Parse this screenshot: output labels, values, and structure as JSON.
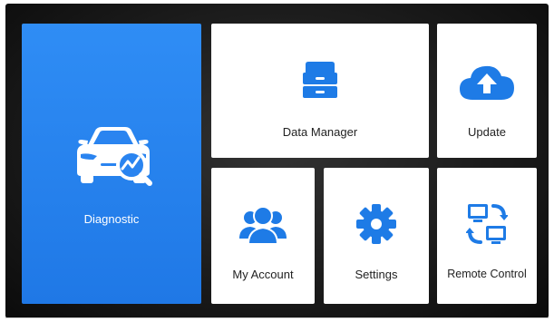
{
  "tiles": {
    "diagnostic": {
      "label": "Diagnostic",
      "icon": "car-diagnostic-icon"
    },
    "data_manager": {
      "label": "Data Manager",
      "icon": "file-cabinet-icon"
    },
    "update": {
      "label": "Update",
      "icon": "cloud-upload-icon"
    },
    "my_account": {
      "label": "My Account",
      "icon": "users-icon"
    },
    "settings": {
      "label": "Settings",
      "icon": "gear-icon"
    },
    "remote_control": {
      "label": "Remote Control",
      "icon": "remote-sync-icon"
    }
  },
  "colors": {
    "accent": "#1f78e6",
    "tile_background": "#ffffff",
    "bezel": "#1c1c1c",
    "label_text": "#222222"
  }
}
